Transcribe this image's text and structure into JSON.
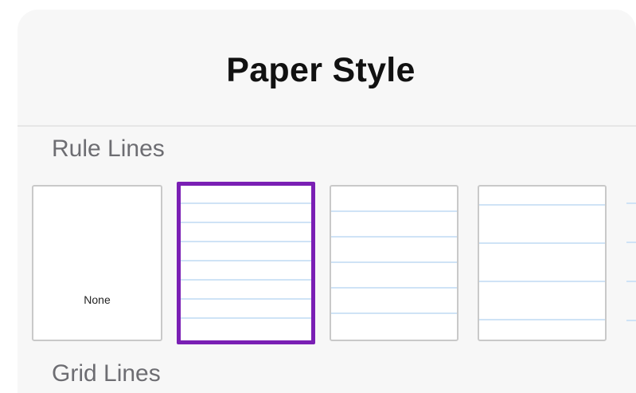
{
  "sheet": {
    "title": "Paper Style"
  },
  "rule_lines": {
    "label": "Rule Lines",
    "options": [
      {
        "id": "none",
        "label": "None",
        "selected": false
      },
      {
        "id": "narrow",
        "label": "",
        "selected": true
      },
      {
        "id": "medium",
        "label": "",
        "selected": false
      },
      {
        "id": "wide",
        "label": "",
        "selected": false
      }
    ]
  },
  "grid_lines": {
    "label": "Grid Lines"
  },
  "colors": {
    "selection": "#7a1fb4",
    "rule_line": "#cfe3f6",
    "panel_background": "#f7f7f7",
    "section_label": "#6d6d72"
  }
}
